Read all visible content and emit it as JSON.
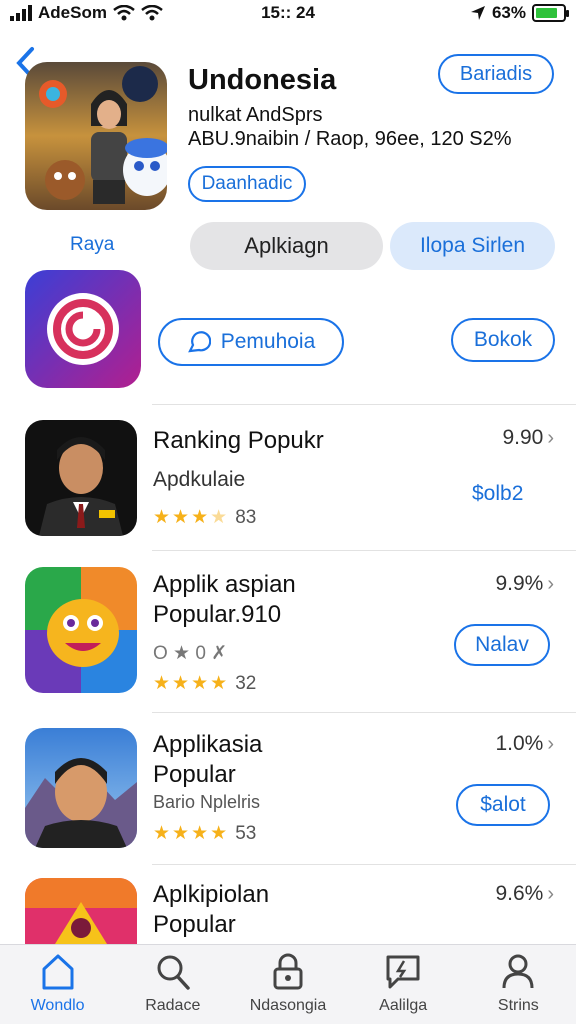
{
  "status_bar": {
    "carrier": "AdeSom",
    "time": "15:: 24",
    "battery": "63%"
  },
  "header": {
    "title": "Undonesia",
    "subtitle": "nulkat AndSprs",
    "meta": "ABU.9naibin / Raop, 96ee, 120 S2%",
    "tag_button": "Daanhadic",
    "top_right_button": "Bariadis",
    "icon_caption": "Raya"
  },
  "segments": {
    "left": "Aplkiagn",
    "right": "Ilopa Sirlen"
  },
  "feature": {
    "action_button": "Pemuhoia",
    "book_button": "Bokok"
  },
  "apps": [
    {
      "title": "Ranking Popukr",
      "subtitle": "Apdkulaie",
      "score": "9.90",
      "price": "$olb2",
      "rating_count": "83",
      "stars": 3.5
    },
    {
      "title": "Applik aspian",
      "title2": "Popular.910",
      "note": "O ★ 0 ✗",
      "score": "9.9%",
      "action": "Nalav",
      "rating_count": "32",
      "stars": 4
    },
    {
      "title": "Applikasia",
      "title2": "Popular",
      "note": "Bario Nplelris",
      "score": "1.0%",
      "action": "$alot",
      "rating_count": "53",
      "stars": 4
    },
    {
      "title": "Aplkipiolan",
      "title2": "Popular",
      "score": "9.6%"
    }
  ],
  "tabs": [
    {
      "label": "Wondlo",
      "icon": "home-icon",
      "active": true
    },
    {
      "label": "Radace",
      "icon": "search-icon"
    },
    {
      "label": "Ndasongia",
      "icon": "lock-icon"
    },
    {
      "label": "Aalilga",
      "icon": "chat-icon"
    },
    {
      "label": "Strins",
      "icon": "person-icon"
    }
  ],
  "colors": {
    "accent": "#1a73e8",
    "star": "#f6b11a",
    "battery": "#2fc23b"
  }
}
